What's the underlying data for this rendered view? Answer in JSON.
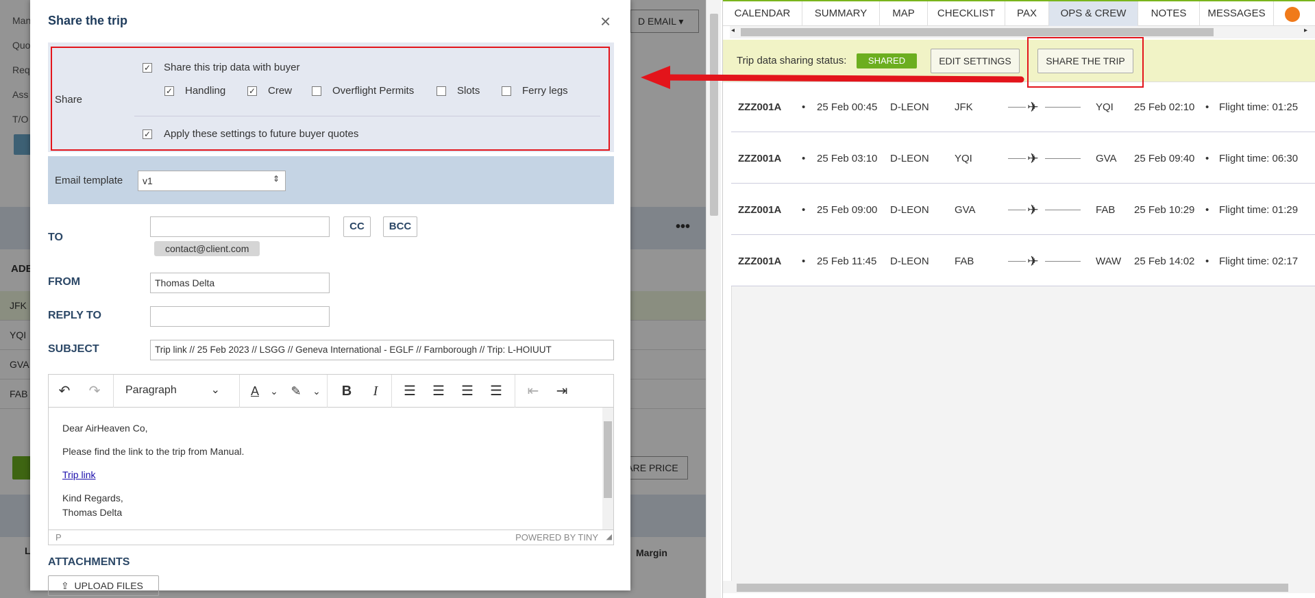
{
  "background": {
    "left_labels": [
      "Man",
      "Quo",
      "Req",
      "Ass",
      "T/O"
    ],
    "send_email_label": "D EMAIL",
    "ade_label": "ADE",
    "airport_rows": [
      "JFK",
      "YQI",
      "GVA",
      "FAB"
    ],
    "are_price_label": "ARE PRICE",
    "margin_label": "Margin",
    "l_label": "L"
  },
  "right_panel": {
    "tabs": [
      "CALENDAR",
      "SUMMARY",
      "MAP",
      "CHECKLIST",
      "PAX",
      "OPS & CREW",
      "NOTES",
      "MESSAGES"
    ],
    "active_tab": "OPS & CREW",
    "sharing_status_label": "Trip data sharing status:",
    "sharing_status_value": "SHARED",
    "edit_settings_label": "EDIT SETTINGS",
    "share_trip_label": "SHARE THE TRIP",
    "flights": [
      {
        "code": "ZZZ001A",
        "dep_time": "25 Feb 00:45",
        "reg": "D-LEON",
        "from": "JFK",
        "to": "YQI",
        "arr_time": "25 Feb 02:10",
        "flight_time": "Flight time: 01:25"
      },
      {
        "code": "ZZZ001A",
        "dep_time": "25 Feb 03:10",
        "reg": "D-LEON",
        "from": "YQI",
        "to": "GVA",
        "arr_time": "25 Feb 09:40",
        "flight_time": "Flight time: 06:30"
      },
      {
        "code": "ZZZ001A",
        "dep_time": "25 Feb 09:00",
        "reg": "D-LEON",
        "from": "GVA",
        "to": "FAB",
        "arr_time": "25 Feb 10:29",
        "flight_time": "Flight time: 01:29"
      },
      {
        "code": "ZZZ001A",
        "dep_time": "25 Feb 11:45",
        "reg": "D-LEON",
        "from": "FAB",
        "to": "WAW",
        "arr_time": "25 Feb 14:02",
        "flight_time": "Flight time: 02:17"
      }
    ]
  },
  "modal": {
    "title": "Share the trip",
    "share_label": "Share",
    "share_with_buyer": "Share this trip data with buyer",
    "options": [
      {
        "label": "Handling",
        "checked": true
      },
      {
        "label": "Crew",
        "checked": true
      },
      {
        "label": "Overflight Permits",
        "checked": false
      },
      {
        "label": "Slots",
        "checked": false
      },
      {
        "label": "Ferry legs",
        "checked": false
      }
    ],
    "apply_future": "Apply these settings to future buyer quotes",
    "email_template_label": "Email template",
    "email_template_value": "v1",
    "to_label": "TO",
    "cc_label": "CC",
    "bcc_label": "BCC",
    "to_recipient": "contact@client.com",
    "from_label": "FROM",
    "from_value": "Thomas Delta",
    "reply_to_label": "REPLY TO",
    "reply_to_value": "",
    "subject_label": "SUBJECT",
    "subject_value": "Trip link // 25 Feb 2023 // LSGG // Geneva International - EGLF // Farnborough // Trip: L-HOIUUT",
    "editor": {
      "block_format": "Paragraph",
      "body_greeting": "Dear AirHeaven Co,",
      "body_line": "Please find the link to the trip from Manual.",
      "body_link": "Trip link",
      "body_regards": "Kind Regards,",
      "body_signature": "Thomas Delta",
      "status_path": "P",
      "powered_by": "POWERED BY TINY"
    },
    "attachments_label": "ATTACHMENTS",
    "upload_label": "UPLOAD FILES"
  }
}
